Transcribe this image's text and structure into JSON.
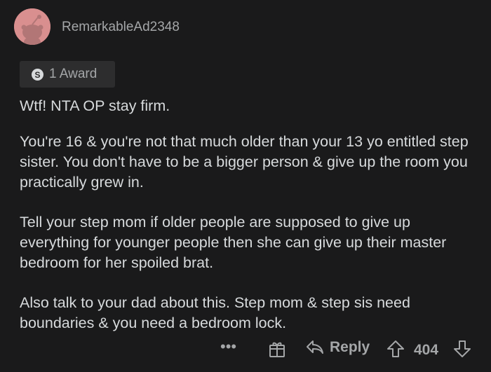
{
  "comment": {
    "username": "RemarkableAd2348",
    "award_label": "1 Award",
    "paragraphs": [
      "Wtf! NTA OP stay firm.",
      "You're 16 & you're not that much older than your 13 yo entitled step sister. You don't have to be a bigger person & give up the room you practically grew in.",
      "Tell your step mom if older people are supposed to give up everything for younger people then she can give up their master bedroom for her spoiled brat.",
      "Also talk to your dad about this. Step mom & step sis need boundaries & you need a bedroom lock."
    ]
  },
  "actions": {
    "more_label": "•••",
    "reply_label": "Reply",
    "score": "404"
  },
  "icons": {
    "avatar": "snoo-avatar-icon",
    "award": "silver-award-icon",
    "gift": "gift-icon",
    "reply": "reply-arrow-icon",
    "upvote": "upvote-arrow-icon",
    "downvote": "downvote-arrow-icon"
  },
  "colors": {
    "background": "#1a1a1b",
    "text": "#d7dadc",
    "muted": "#a4a6a8",
    "avatar_bg": "#d98f8f"
  }
}
